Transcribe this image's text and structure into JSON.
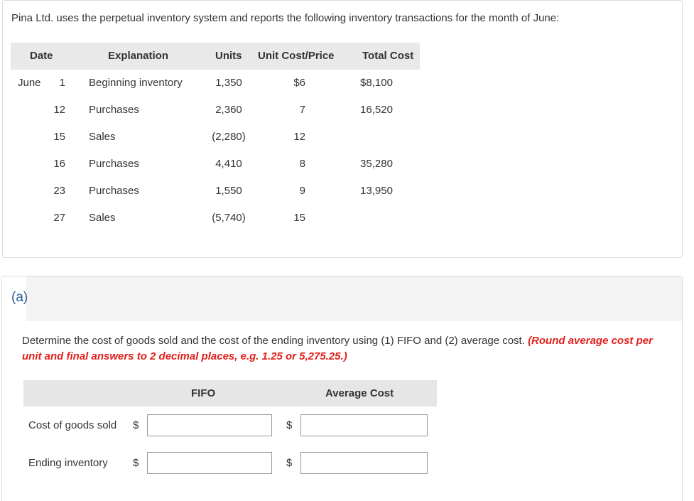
{
  "intro": "Pina Ltd. uses the perpetual inventory system and reports the following inventory transactions for the month of June:",
  "table": {
    "headers": {
      "date": "Date",
      "explanation": "Explanation",
      "units": "Units",
      "unit_cost": "Unit Cost/Price",
      "total_cost": "Total Cost"
    },
    "rows": [
      {
        "month": "June",
        "day": "1",
        "explanation": "Beginning inventory",
        "units": "1,350",
        "unit_cost": "$6",
        "total_cost": "$8,100"
      },
      {
        "month": "",
        "day": "12",
        "explanation": "Purchases",
        "units": "2,360",
        "unit_cost": "7",
        "total_cost": "16,520"
      },
      {
        "month": "",
        "day": "15",
        "explanation": "Sales",
        "units": "(2,280)",
        "unit_cost": "12",
        "total_cost": ""
      },
      {
        "month": "",
        "day": "16",
        "explanation": "Purchases",
        "units": "4,410",
        "unit_cost": "8",
        "total_cost": "35,280"
      },
      {
        "month": "",
        "day": "23",
        "explanation": "Purchases",
        "units": "1,550",
        "unit_cost": "9",
        "total_cost": "13,950"
      },
      {
        "month": "",
        "day": "27",
        "explanation": "Sales",
        "units": "(5,740)",
        "unit_cost": "15",
        "total_cost": ""
      }
    ]
  },
  "part": {
    "label": "(a)"
  },
  "question": {
    "text": "Determine the cost of goods sold and the cost of the ending inventory using (1) FIFO and (2) average cost. ",
    "note": "(Round average cost per unit and final answers to 2 decimal places, e.g. 1.25 or 5,275.25.)"
  },
  "answer": {
    "headers": {
      "fifo": "FIFO",
      "average": "Average Cost"
    },
    "rows": [
      {
        "label": "Cost of goods sold",
        "currency": "$",
        "fifo_value": "",
        "avg_value": ""
      },
      {
        "label": "Ending inventory",
        "currency": "$",
        "fifo_value": "",
        "avg_value": ""
      }
    ]
  },
  "colors": {
    "note_red": "#e0201c",
    "part_blue": "#2a5d8f",
    "header_bg": "#e9e9e9"
  }
}
